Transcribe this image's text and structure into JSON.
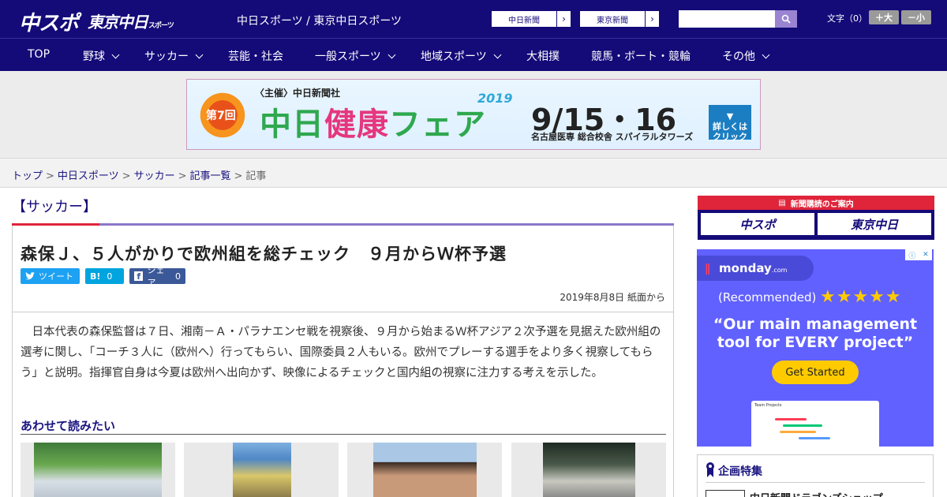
{
  "header": {
    "logo_chuspo": "中スポ",
    "logo_tokyo": "東京中日",
    "logo_tokyo_small": "スポーツ",
    "site_title": "中日スポーツ / 東京中日スポーツ",
    "paper_links": [
      "中日新聞",
      "東京新聞"
    ],
    "search_placeholder": "",
    "font_label": "文字（0）",
    "font_increase": "＋大",
    "font_decrease": "－小"
  },
  "nav": {
    "items": [
      {
        "label": "TOP",
        "dropdown": false
      },
      {
        "label": "野球",
        "dropdown": true
      },
      {
        "label": "サッカー",
        "dropdown": true
      },
      {
        "label": "芸能・社会",
        "dropdown": false
      },
      {
        "label": "一般スポーツ",
        "dropdown": true
      },
      {
        "label": "地域スポーツ",
        "dropdown": true
      },
      {
        "label": "大相撲",
        "dropdown": false
      },
      {
        "label": "競馬・ボート・競輪",
        "dropdown": false
      },
      {
        "label": "その他",
        "dropdown": true
      }
    ]
  },
  "banner": {
    "badge": "第7回",
    "sponsor": "〈主催〉中日新聞社",
    "title_a": "中日",
    "title_b": "健康",
    "title_c": "フェア",
    "year": "2019",
    "date": "9/15・16",
    "venue": "名古屋医専 総合校舎 スパイラルタワーズ",
    "cta": "詳しくはクリック"
  },
  "breadcrumb": [
    "トップ",
    "中日スポーツ",
    "サッカー",
    "記事一覧",
    "記事"
  ],
  "article": {
    "category": "【サッカー】",
    "headline": "森保Ｊ、５人がかりで欧州組を総チェック　９月からＷ杯予選",
    "share_tweet": "ツイート",
    "share_hatena": "B!",
    "share_hatena_count": "0",
    "share_facebook": "シェア",
    "share_facebook_count": "0",
    "date": "2019年8月8日 紙面から",
    "body": "日本代表の森保監督は７日、湘南－Ａ・パラナエンセ戦を視察後、９月から始まるＷ杯アジア２次予選を見据えた欧州組の選考に関し、「コーチ３人に（欧州へ）行ってもらい、国際委員２人もいる。欧州でプレーする選手をより多く視察してもらう」と説明。指揮官自身は今夏は欧州へ出向かず、映像によるチェックと国内組の視察に注力する考えを示した。",
    "related_title": "あわせて読みたい"
  },
  "sidebar": {
    "subscribe_title": "新聞購読のご案内",
    "subscribe_logos": [
      "中スポ",
      "東京中日"
    ],
    "ad": {
      "brand": "monday",
      "brand_suffix": ".com",
      "recommended": "(Recommended)",
      "quote": "“Our main management tool for EVERY project”",
      "cta": "Get Started",
      "mock_title": "Team Projects"
    },
    "feature_title": "企画特集",
    "feature_item": "中日新聞ドラゴンズショップ"
  }
}
